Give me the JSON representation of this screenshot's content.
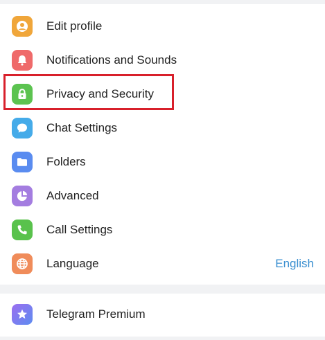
{
  "settings_menu": {
    "items": [
      {
        "label": "Edit profile",
        "icon": "profile-icon",
        "color": "#f0a63a"
      },
      {
        "label": "Notifications and Sounds",
        "icon": "bell-icon",
        "color": "#ef6a6a"
      },
      {
        "label": "Privacy and Security",
        "icon": "lock-icon",
        "color": "#5cc350"
      },
      {
        "label": "Chat Settings",
        "icon": "chat-bubble-icon",
        "color": "#45abe9"
      },
      {
        "label": "Folders",
        "icon": "folder-icon",
        "color": "#5a8cf0"
      },
      {
        "label": "Advanced",
        "icon": "pie-chart-icon",
        "color": "#a47de0"
      },
      {
        "label": "Call Settings",
        "icon": "phone-icon",
        "color": "#59c24c"
      },
      {
        "label": "Language",
        "icon": "globe-icon",
        "color": "#f08c5a",
        "value": "English"
      }
    ],
    "highlighted_item": "Privacy and Security"
  },
  "premium": {
    "label": "Telegram Premium",
    "icon": "star-icon",
    "color_start": "#9b6ef0",
    "color_end": "#5e8cf0"
  },
  "colors": {
    "highlight_border": "#d8202b",
    "value_text": "#3a8fd0"
  }
}
